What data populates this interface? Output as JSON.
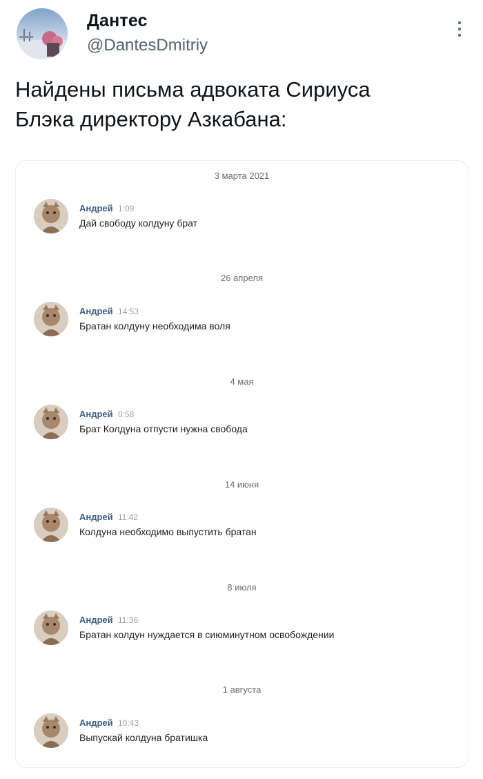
{
  "tweet": {
    "display_name": "Дантес",
    "handle": "@DantesDmitriy",
    "text_line1": "Найдены письма адвоката Сириуса",
    "text_line2": "Блэка директору Азкабана:"
  },
  "chat": {
    "groups": [
      {
        "date": "3 марта 2021",
        "author": "Андрей",
        "time": "1:09",
        "text": "Дай свободу колдуну брат"
      },
      {
        "date": "26 апреля",
        "author": "Андрей",
        "time": "14:53",
        "text": "Братан колдуну необходима воля"
      },
      {
        "date": "4 мая",
        "author": "Андрей",
        "time": "0:58",
        "text": "Брат Колдуна отпусти нужна свобода"
      },
      {
        "date": "14 июня",
        "author": "Андрей",
        "time": "11:42",
        "text": "Колдуна необходимо выпустить братан"
      },
      {
        "date": "8 июля",
        "author": "Андрей",
        "time": "11:36",
        "text": "Братан колдун нуждается в сиюминутном освобождении"
      },
      {
        "date": "1 августа",
        "author": "Андрей",
        "time": "10:43",
        "text": "Выпускай колдуна братишка"
      }
    ]
  }
}
